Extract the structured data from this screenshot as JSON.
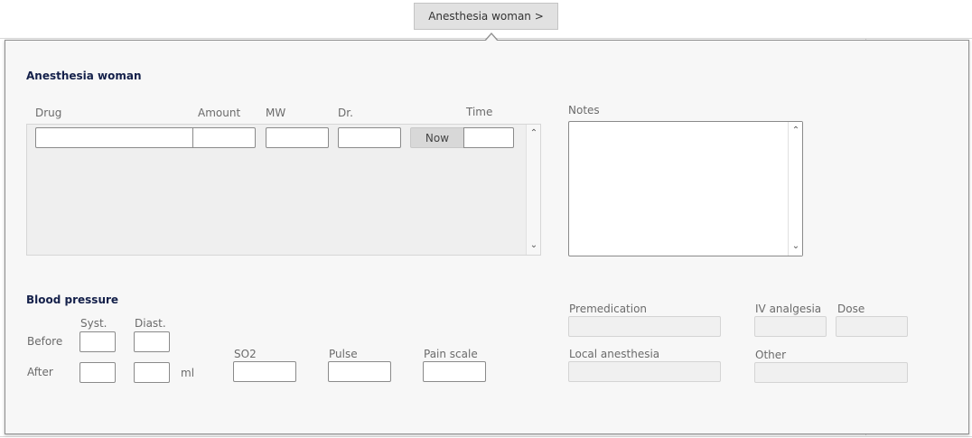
{
  "trigger": {
    "label": "Anesthesia woman >"
  },
  "panel": {
    "title": "Anesthesia woman",
    "drug_table": {
      "columns": {
        "drug": "Drug",
        "amount": "Amount",
        "mw": "MW",
        "dr": "Dr.",
        "time": "Time"
      },
      "row": {
        "drug": "",
        "amount": "",
        "mw": "",
        "dr": "",
        "time": ""
      },
      "now_button": "Now"
    },
    "notes": {
      "label": "Notes",
      "value": ""
    },
    "blood_pressure": {
      "title": "Blood pressure",
      "syst_label": "Syst.",
      "diast_label": "Diast.",
      "before_label": "Before",
      "after_label": "After",
      "unit": "ml",
      "so2_label": "SO2",
      "pulse_label": "Pulse",
      "pain_label": "Pain scale",
      "values": {
        "before_syst": "",
        "before_diast": "",
        "after_syst": "",
        "after_diast": "",
        "so2": "",
        "pulse": "",
        "pain": ""
      }
    },
    "side_fields": {
      "premedication": "Premedication",
      "iv_analgesia": "IV analgesia",
      "dose": "Dose",
      "local_anesthesia": "Local anesthesia",
      "other": "Other"
    }
  },
  "icons": {
    "scroll_up": "chevron-up-icon",
    "scroll_down": "chevron-down-icon"
  },
  "colors": {
    "title": "#14204a",
    "panel_bg": "#f7f7f7",
    "table_bg": "#efefef",
    "button_bg": "#d8d8d8"
  }
}
